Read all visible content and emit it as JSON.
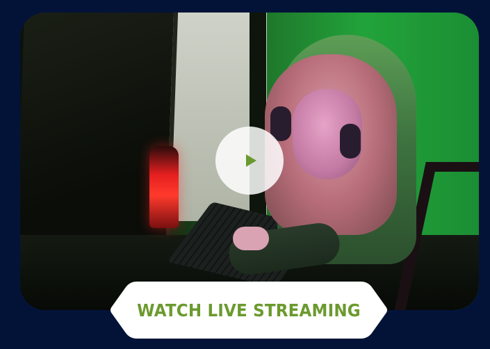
{
  "video": {
    "play_icon": "play-icon",
    "accent_color": "#6b9a2e"
  },
  "cta": {
    "label": "WATCH LIVE STREAMING"
  },
  "colors": {
    "background": "#031338",
    "button_bg": "#ffffff",
    "button_text": "#6b9a2e"
  }
}
